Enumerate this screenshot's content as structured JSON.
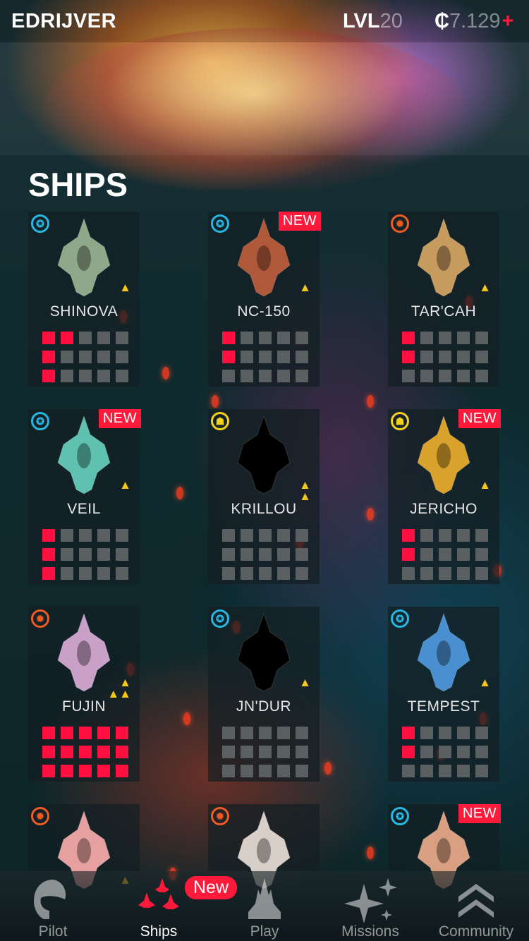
{
  "header": {
    "player_name": "EDRIJVER",
    "level_label": "LVL",
    "level_value": "20",
    "credits_symbol": "₵",
    "credits_value": "7.129",
    "add_credits_label": "+"
  },
  "section_title": "SHIPS",
  "new_label": "NEW",
  "ships": [
    {
      "name": "SHINOVA",
      "class": "blue-class-icon",
      "is_new": false,
      "rank": 1,
      "upgrade_rows": [
        2,
        1,
        1
      ],
      "color": "#8fa88a"
    },
    {
      "name": "NC-150",
      "class": "blue-class-icon",
      "is_new": true,
      "rank": 1,
      "upgrade_rows": [
        1,
        1,
        0
      ],
      "color": "#b0583a"
    },
    {
      "name": "TAR'CAH",
      "class": "orange-class-icon",
      "is_new": false,
      "rank": 1,
      "upgrade_rows": [
        1,
        1,
        0
      ],
      "color": "#c79a5e"
    },
    {
      "name": "VEIL",
      "class": "blue-class-icon",
      "is_new": true,
      "rank": 1,
      "upgrade_rows": [
        1,
        1,
        1
      ],
      "color": "#5fc2b0"
    },
    {
      "name": "KRILLOU",
      "class": "yellow-class-icon",
      "is_new": false,
      "rank": 2,
      "upgrade_rows": [
        0,
        0,
        0
      ],
      "color": "#000000"
    },
    {
      "name": "JERICHO",
      "class": "yellow-class-icon",
      "is_new": true,
      "rank": 1,
      "upgrade_rows": [
        1,
        1,
        0
      ],
      "color": "#d9a22c"
    },
    {
      "name": "FUJIN",
      "class": "orange-class-icon",
      "is_new": false,
      "rank": 3,
      "upgrade_rows": [
        5,
        5,
        5
      ],
      "color": "#c9a0c8"
    },
    {
      "name": "JN'DUR",
      "class": "blue-class-icon",
      "is_new": false,
      "rank": 1,
      "upgrade_rows": [
        0,
        0,
        0
      ],
      "color": "#000000"
    },
    {
      "name": "TEMPEST",
      "class": "blue-class-icon",
      "is_new": false,
      "rank": 1,
      "upgrade_rows": [
        1,
        1,
        0
      ],
      "color": "#4a8fd0"
    },
    {
      "name": "",
      "class": "orange-class-icon",
      "is_new": false,
      "rank": 1,
      "upgrade_rows": [],
      "color": "#e6a0a0"
    },
    {
      "name": "",
      "class": "orange-class-icon",
      "is_new": false,
      "rank": 0,
      "upgrade_rows": [],
      "color": "#d8cfc8"
    },
    {
      "name": "",
      "class": "blue-class-icon",
      "is_new": true,
      "rank": 0,
      "upgrade_rows": [],
      "color": "#d8a080"
    }
  ],
  "nav": {
    "items": [
      {
        "label": "Pilot",
        "icon": "helmet-icon"
      },
      {
        "label": "Ships",
        "icon": "ships-icon",
        "active": true
      },
      {
        "label": "Play",
        "icon": "rocket-icon"
      },
      {
        "label": "Missions",
        "icon": "sparkle-icon"
      },
      {
        "label": "Community",
        "icon": "chevrons-up-icon"
      }
    ],
    "ships_badge": "New"
  },
  "colors": {
    "accent_red": "#ff1a3c",
    "rank_gold": "#f5c518",
    "class_blue": "#27b7e3",
    "class_orange": "#f05a23",
    "class_yellow": "#f2d21b"
  }
}
